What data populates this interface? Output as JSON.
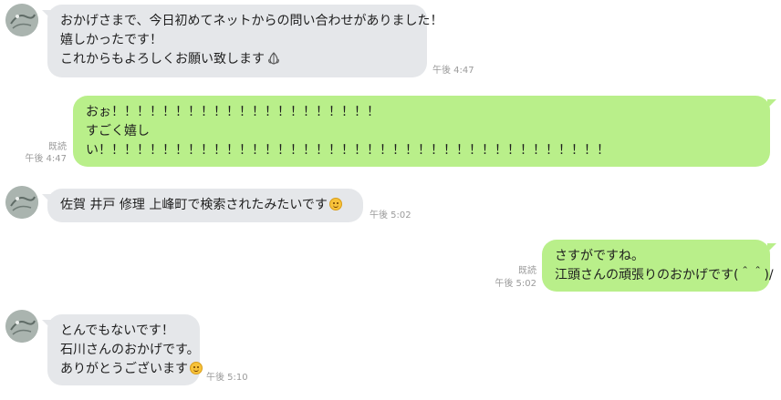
{
  "messages": [
    {
      "side": "in",
      "lines": [
        "おかげさまで、今日初めてネットからの問い合わせがありました！",
        "嬉しかったです！",
        "これからもよろしくお願い致します"
      ],
      "emoji": "praying-hands-icon",
      "time": "午後 4:47"
    },
    {
      "side": "out",
      "lines": [
        "おぉ！！！！！！！！！！！！！！！！！！！！！",
        "すごく嬉し",
        "い！！！！！！！！！！！！！！！！！！！！！！！！！！！！！！！！！！！！！！！！"
      ],
      "read": "既読",
      "time": "午後 4:47"
    },
    {
      "side": "in",
      "lines": [
        "佐賀 井戸 修理 上峰町で検索されたみたいです"
      ],
      "emoji": "smile-icon",
      "time": "午後 5:02"
    },
    {
      "side": "out",
      "lines": [
        "さすがですね。",
        "江頭さんの頑張りのおかげです(＾＾)/"
      ],
      "read": "既読",
      "time": "午後 5:02"
    },
    {
      "side": "in",
      "lines": [
        "とんでもないです！",
        "石川さんのおかげです。",
        "ありがとうございます"
      ],
      "emoji": "smile-icon",
      "time": "午後 5:10"
    }
  ],
  "colors": {
    "incoming_bubble": "#e5e7ea",
    "outgoing_bubble": "#b9ef8a",
    "meta_text": "#9a9a9a"
  }
}
